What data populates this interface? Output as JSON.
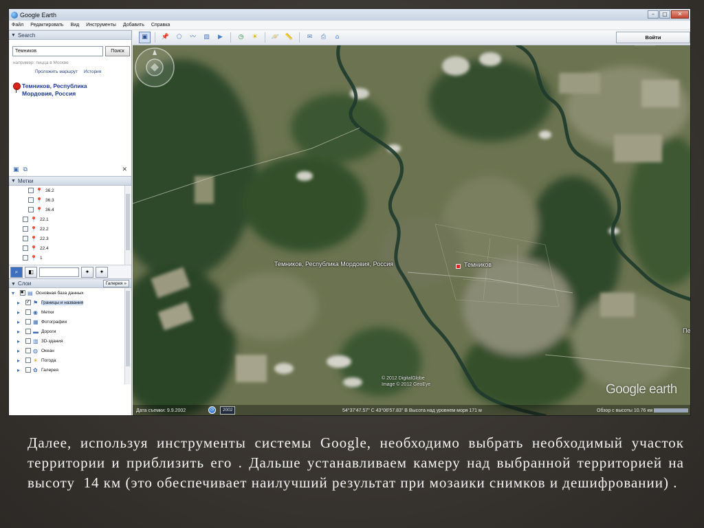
{
  "window": {
    "title": "Google Earth"
  },
  "menu": [
    "Файл",
    "Редактировать",
    "Вид",
    "Инструменты",
    "Добавить",
    "Справка"
  ],
  "search": {
    "header": "Search",
    "query": "Темников",
    "button": "Поиск",
    "hint": "например: пицца в Москве",
    "route_link": "Проложить маршрут",
    "history_link": "История",
    "result": "Темников, Республика Мордовия, Россия"
  },
  "places": {
    "header": "Метки",
    "items": [
      "36.2",
      "36.3",
      "36.4",
      "22.1",
      "22.2",
      "22.3",
      "22.4",
      "1"
    ]
  },
  "layers": {
    "header": "Слои",
    "gallery_button": "Галерея",
    "items": [
      "Основная база данных",
      "Границы и названия",
      "Метки",
      "Фотографии",
      "Дороги",
      "3D-здания",
      "Океан",
      "Погода",
      "Галерея"
    ]
  },
  "toolbar": {
    "signin": "Войти"
  },
  "map": {
    "place_label": "Темников, Республика Мордовия, Россия",
    "town_label": "Темников",
    "edge_label": "Пе",
    "copyright": "© 2012 DigitalGlobe\nImage © 2012 GeoEye",
    "watermark": "Google earth"
  },
  "status": {
    "image_date": "Дата съемки: 9.9.2002",
    "year": "2002",
    "coords": "54°37'47.57\" С 43°06'57.83\" В  Высота над уровнем моря 171 м",
    "eye_alt": "Обзор с высоты 10.76 км"
  },
  "caption": "Далее, используя инструменты системы Google, необходимо выбрать необходимый участок территории и приблизить его . Дальше устанавливаем камеру над выбранной территорией на высоту  14 км (это обеспечивает наилучший результат при мозаики снимков и дешифровании) ."
}
